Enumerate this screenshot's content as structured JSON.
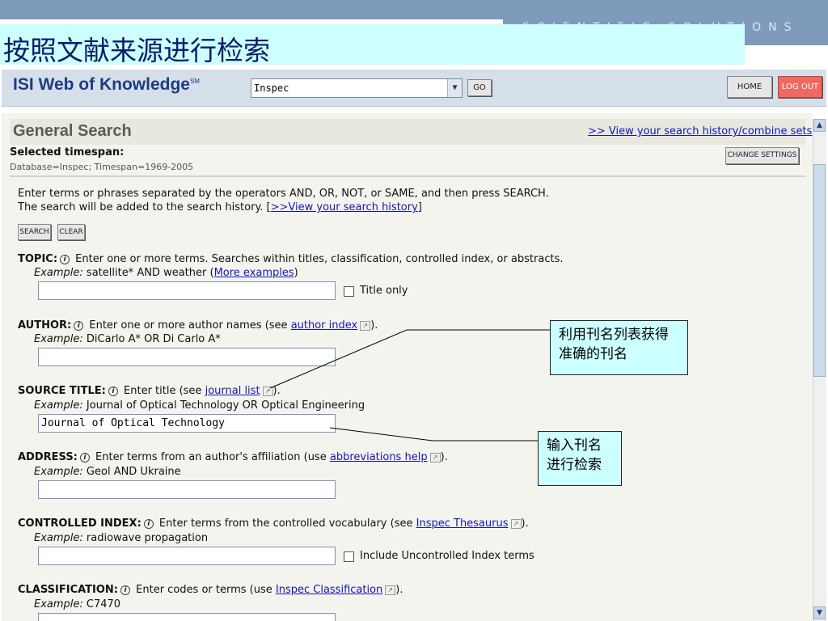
{
  "slide": {
    "title": "按照文献来源进行检索",
    "brand": "SCIENTIFIC SOLUTIONS"
  },
  "header": {
    "logo": "ISI Web of Knowledge",
    "logo_sup": "SM",
    "database": "Inspec",
    "go_label": "GO",
    "home_label": "HOME",
    "logout_label": "LOG OUT"
  },
  "search": {
    "title": "General Search",
    "history_link": ">> View your search history/combine sets",
    "timespan_label": "Selected timespan:",
    "timespan_value": "Database=Inspec; Timespan=1969-2005",
    "change_settings": "CHANGE SETTINGS",
    "instructions_1": "Enter terms or phrases separated by the operators AND, OR, NOT, or SAME, and then press SEARCH.",
    "instructions_2": "The search will be added to the search history. [",
    "instructions_link": ">>View your search history",
    "instructions_end": "]",
    "search_btn": "SEARCH",
    "clear_btn": "CLEAR"
  },
  "fields": {
    "topic": {
      "label": "TOPIC:",
      "desc": "Enter one or more terms. Searches within titles, classification, controlled index, or abstracts.",
      "example_prefix": "Example:",
      "example": "satellite* AND weather (",
      "example_link": "More examples",
      "example_end": ")",
      "value": "",
      "checkbox_label": "Title only"
    },
    "author": {
      "label": "AUTHOR:",
      "desc": "Enter one or more author names (see",
      "link": "author index",
      "end": ").",
      "example_prefix": "Example:",
      "example": "DiCarlo A* OR Di Carlo A*",
      "value": ""
    },
    "source": {
      "label": "SOURCE TITLE:",
      "desc": "Enter title (see",
      "link": "journal list",
      "end": ").",
      "example_prefix": "Example:",
      "example": "Journal of Optical Technology OR Optical Engineering",
      "value": "Journal of Optical Technology"
    },
    "address": {
      "label": "ADDRESS:",
      "desc": "Enter terms from an author's affiliation (use",
      "link": "abbreviations help",
      "end": ").",
      "example_prefix": "Example:",
      "example": "Geol AND Ukraine",
      "value": ""
    },
    "controlled": {
      "label": "CONTROLLED INDEX:",
      "desc": "Enter terms from the controlled vocabulary (see",
      "link": "Inspec Thesaurus",
      "end": ").",
      "example_prefix": "Example:",
      "example": "radiowave propagation",
      "value": "",
      "checkbox_label": "Include Uncontrolled Index terms"
    },
    "classification": {
      "label": "CLASSIFICATION:",
      "desc": "Enter codes or terms (use",
      "link": "Inspec Classification",
      "end": ").",
      "example_prefix": "Example:",
      "example": "C7470",
      "value": ""
    }
  },
  "callouts": {
    "journal_list": "利用刊名列表获得准确的刊名",
    "input_title": "输入刊名进行检索"
  }
}
